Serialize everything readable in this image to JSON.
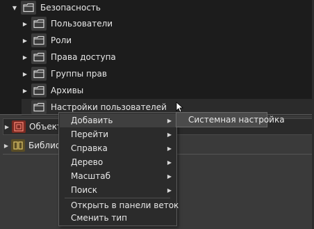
{
  "tree": {
    "root": {
      "label": "Безопасность",
      "expanded": true
    },
    "children": [
      {
        "label": "Пользователи",
        "expandable": true
      },
      {
        "label": "Роли",
        "expandable": true
      },
      {
        "label": "Права доступа",
        "expandable": true
      },
      {
        "label": "Группы прав",
        "expandable": true
      },
      {
        "label": "Архивы",
        "expandable": true
      },
      {
        "label": "Настройки пользователей",
        "expandable": false,
        "selected": true
      }
    ]
  },
  "sections": [
    {
      "label": "Объекты",
      "icon": "objects-red-icon"
    },
    {
      "label": "Библиотеки",
      "icon": "library-icon"
    }
  ],
  "context_menu": {
    "items": [
      {
        "label": "Добавить",
        "has_submenu": true,
        "active": true
      },
      {
        "label": "Перейти",
        "has_submenu": true
      },
      {
        "label": "Справка",
        "has_submenu": true
      },
      {
        "label": "Дерево",
        "has_submenu": true
      },
      {
        "label": "Масштаб",
        "has_submenu": true
      },
      {
        "label": "Поиск",
        "has_submenu": true
      },
      {
        "label": "Открыть в панели веток",
        "has_submenu": false
      },
      {
        "label": "Сменить тип",
        "has_submenu": false
      }
    ],
    "submenu": {
      "label": "Системная настройка"
    }
  },
  "colors": {
    "panel": "#1c1c1c",
    "menu": "#2b2b2b",
    "highlight": "#4b4b4b",
    "objects_icon": "#c0392b",
    "library_icon": "#a08a3c"
  }
}
